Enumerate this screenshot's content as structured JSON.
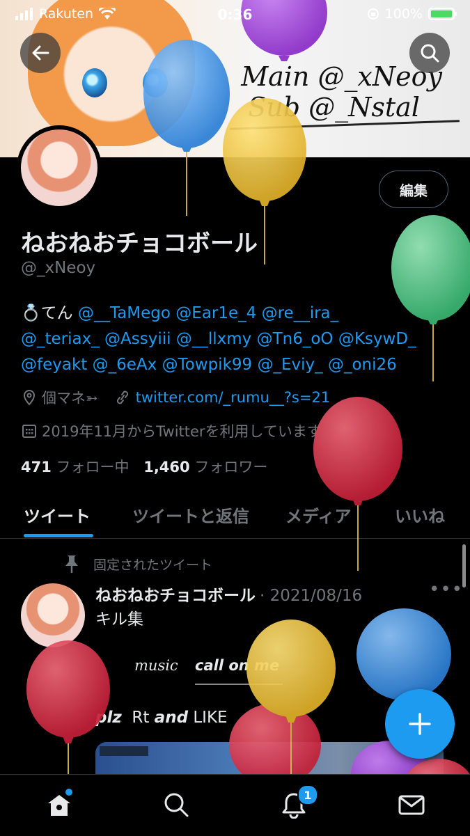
{
  "status_bar": {
    "carrier": "Rakuten",
    "time": "0:36",
    "battery": "100%"
  },
  "banner": {
    "line1": "Main @_xNeoy",
    "line2": "Sub @_Nstal_"
  },
  "header": {
    "edit_label": "編集"
  },
  "profile": {
    "display_name": "ねおねおチョコボール",
    "handle": "@_xNeoy",
    "bio_prefix": "💍てん",
    "bio_mentions": [
      "@__TaMego",
      "@Ear1e_4",
      "@re__ira_",
      "@_teriax_",
      "@Assyiii",
      "@__llxmy",
      "@Tn6_oO",
      "@KsywD_",
      "@feyakt",
      "@_6eAx",
      "@Towpik99",
      "@_Eviy_",
      "@_oni26"
    ],
    "location": "個マネ➳",
    "website": "twitter.com/_rumu__?s=21",
    "joined": "2019年11月からTwitterを利用しています",
    "following_count": "471",
    "following_label": "フォロー中",
    "followers_count": "1,460",
    "followers_label": "フォロワー"
  },
  "tabs": [
    "ツイート",
    "ツイートと返信",
    "メディア",
    "いいね"
  ],
  "tweet": {
    "pinned_label": "固定されたツイート",
    "author": "ねおねおチョコボール",
    "date": "· 2021/08/16",
    "more": "•••",
    "text": "キル集",
    "music": "music",
    "call": "call on me",
    "plz": "plz",
    "rt": "Rt",
    "and": "and",
    "like": "LIKE"
  },
  "bottom_nav": {
    "notifications_badge": "1"
  },
  "colors": {
    "accent": "#1d9bf0",
    "background": "#000000",
    "muted": "#71767b"
  },
  "icons": [
    "back-arrow-icon",
    "search-icon",
    "location-icon",
    "link-icon",
    "calendar-icon",
    "pin-icon",
    "home-icon",
    "notifications-icon",
    "messages-icon",
    "compose-plus-icon"
  ]
}
